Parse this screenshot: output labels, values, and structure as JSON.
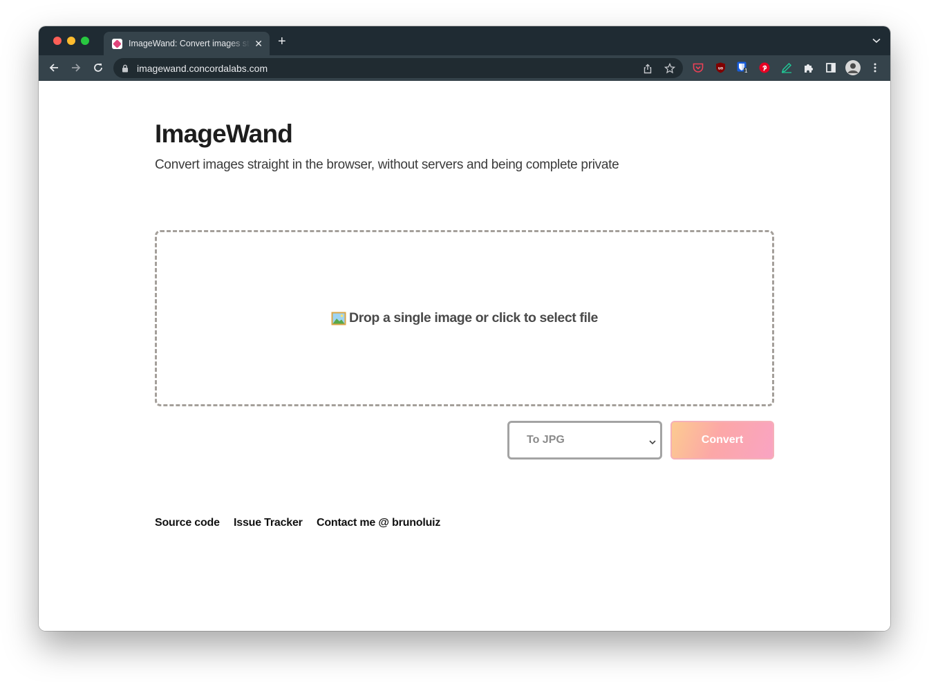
{
  "browser": {
    "tab": {
      "title": "ImageWand: Convert images straight in the browser",
      "close_glyph": "✕"
    },
    "new_tab_glyph": "+",
    "tab_menu_glyph": "⌄",
    "url": "imagewand.concordalabs.com",
    "extensions": [
      "pocket-icon",
      "ublock-icon",
      "bitwarden-icon",
      "pinterest-icon",
      "pen-icon",
      "puzzle-icon",
      "sidepanel-icon"
    ],
    "bitwarden_badge": "1"
  },
  "page": {
    "title": "ImageWand",
    "subtitle": "Convert images straight in the browser, without servers and being complete private",
    "dropzone": {
      "emoji": "🖼️",
      "text": "Drop a single image or click to select file"
    },
    "format_select": {
      "selected": "To JPG"
    },
    "convert_label": "Convert",
    "footer_links": [
      "Source code",
      "Issue Tracker",
      "Contact me @ brunoluiz"
    ]
  },
  "colors": {
    "tabstrip": "#1f2b33",
    "toolbar": "#35434b",
    "dropzone_border": "#a49f9a",
    "convert_gradient": [
      "#fccb90",
      "#fca7a7",
      "#f9a4c3"
    ]
  }
}
